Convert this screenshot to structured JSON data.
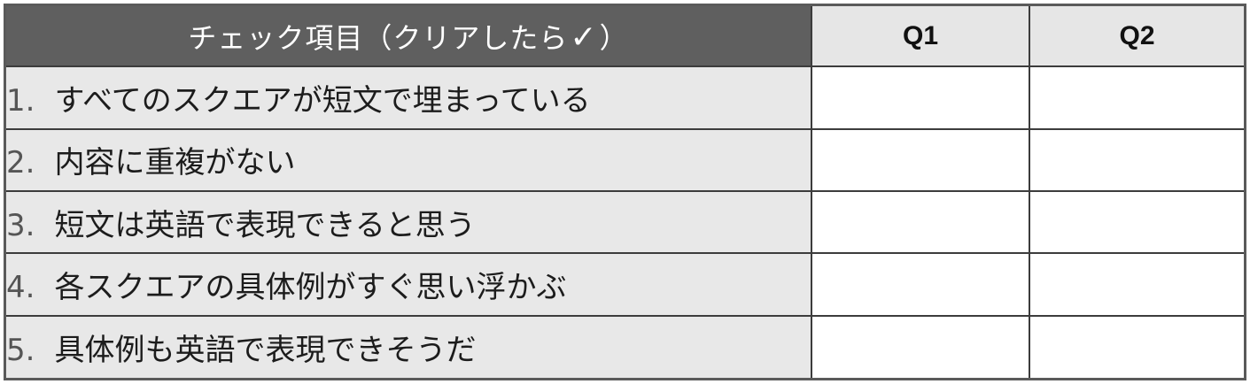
{
  "header": {
    "item_title_prefix": "チェック項目（クリアしたら",
    "item_title_check": "✓",
    "item_title_suffix": "）",
    "q1": "Q1",
    "q2": "Q2"
  },
  "rows": [
    {
      "num": "1.",
      "text": "すべてのスクエアが短文で埋まっている"
    },
    {
      "num": "2.",
      "text": "内容に重複がない"
    },
    {
      "num": "3.",
      "text": "短文は英語で表現できると思う"
    },
    {
      "num": "4.",
      "text": "各スクエアの具体例がすぐ思い浮かぶ"
    },
    {
      "num": "5.",
      "text": "具体例も英語で表現できそうだ"
    }
  ]
}
